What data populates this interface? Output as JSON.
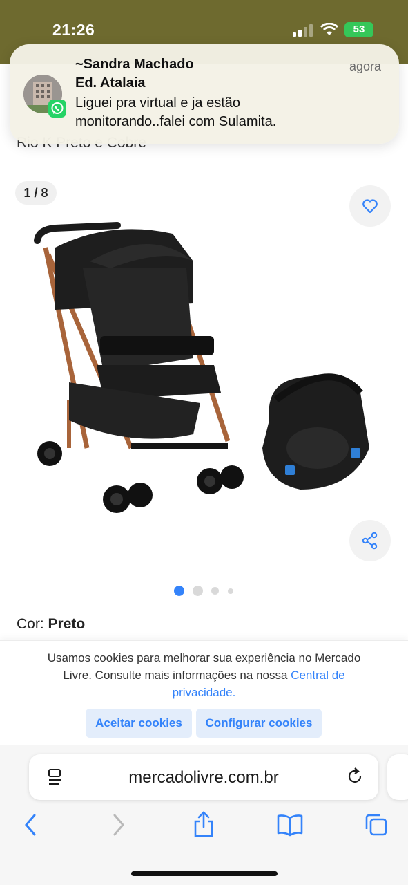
{
  "status": {
    "time": "21:26",
    "battery": "53"
  },
  "notification": {
    "sender": "~Sandra Machado",
    "group": "Ed. Atalaia",
    "message": "Liguei  pra virtual  e ja estão monitorando..falei com Sulamita.",
    "time": "agora"
  },
  "product": {
    "title": "Rio K Preto e Cobre",
    "counter": "1 / 8",
    "color_label": "Cor:",
    "color_value": "Preto"
  },
  "cookie": {
    "text": "Usamos cookies para melhorar sua experiência no Mercado Livre. Consulte mais informações na nossa",
    "link": "Central de privacidade.",
    "accept": "Aceitar cookies",
    "configure": "Configurar cookies"
  },
  "browser": {
    "url": "mercadolivre.com.br"
  },
  "colors": {
    "accent": "#3483fa",
    "statusbar": "#6e6a2f",
    "whatsapp": "#25d366"
  }
}
